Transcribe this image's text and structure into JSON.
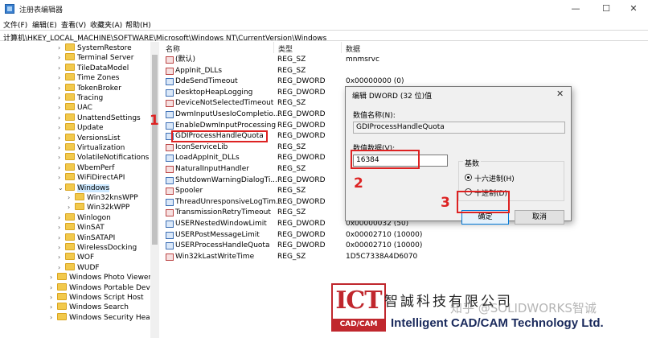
{
  "window": {
    "title": "注册表编辑器"
  },
  "titlebar_buttons": {
    "minimize": "—",
    "maximize": "☐",
    "close": "✕"
  },
  "menu": [
    "文件(F)",
    "编辑(E)",
    "查看(V)",
    "收藏夹(A)",
    "帮助(H)"
  ],
  "address": "计算机\\HKEY_LOCAL_MACHINE\\SOFTWARE\\Microsoft\\Windows NT\\CurrentVersion\\Windows",
  "tree": [
    {
      "label": "SystemRestore",
      "indent": 1
    },
    {
      "label": "Terminal Server",
      "indent": 1
    },
    {
      "label": "TileDataModel",
      "indent": 1
    },
    {
      "label": "Time Zones",
      "indent": 1
    },
    {
      "label": "TokenBroker",
      "indent": 1
    },
    {
      "label": "Tracing",
      "indent": 1
    },
    {
      "label": "UAC",
      "indent": 1
    },
    {
      "label": "UnattendSettings",
      "indent": 1
    },
    {
      "label": "Update",
      "indent": 1
    },
    {
      "label": "VersionsList",
      "indent": 1
    },
    {
      "label": "Virtualization",
      "indent": 1
    },
    {
      "label": "VolatileNotifications",
      "indent": 1
    },
    {
      "label": "WbemPerf",
      "indent": 1
    },
    {
      "label": "WiFiDirectAPI",
      "indent": 1
    },
    {
      "label": "Windows",
      "indent": 1,
      "selected": true,
      "open": true
    },
    {
      "label": "Win32knsWPP",
      "indent": 2
    },
    {
      "label": "Win32kWPP",
      "indent": 2
    },
    {
      "label": "Winlogon",
      "indent": 1
    },
    {
      "label": "WinSAT",
      "indent": 1
    },
    {
      "label": "WinSATAPI",
      "indent": 1
    },
    {
      "label": "WirelessDocking",
      "indent": 1
    },
    {
      "label": "WOF",
      "indent": 1
    },
    {
      "label": "WUDF",
      "indent": 1
    },
    {
      "label": "Windows Photo Viewer",
      "indent": 0
    },
    {
      "label": "Windows Portable Devices",
      "indent": 0
    },
    {
      "label": "Windows Script Host",
      "indent": 0
    },
    {
      "label": "Windows Search",
      "indent": 0
    },
    {
      "label": "Windows Security Health",
      "indent": 0
    }
  ],
  "columns": {
    "name": "名称",
    "type": "类型",
    "data": "数据"
  },
  "values": [
    {
      "name": "(默认)",
      "type": "REG_SZ",
      "data": "mnmsrvc",
      "kind": "sz"
    },
    {
      "name": "AppInit_DLLs",
      "type": "REG_SZ",
      "data": "",
      "kind": "sz"
    },
    {
      "name": "DdeSendTimeout",
      "type": "REG_DWORD",
      "data": "0x00000000 (0)",
      "kind": "dw"
    },
    {
      "name": "DesktopHeapLogging",
      "type": "REG_DWORD",
      "data": "",
      "kind": "dw"
    },
    {
      "name": "DeviceNotSelectedTimeout",
      "type": "REG_SZ",
      "data": "",
      "kind": "sz"
    },
    {
      "name": "DwmInputUsesIoCompletio...",
      "type": "REG_DWORD",
      "data": "",
      "kind": "dw"
    },
    {
      "name": "EnableDwmInputProcessing",
      "type": "REG_DWORD",
      "data": "",
      "kind": "dw"
    },
    {
      "name": "GDIProcessHandleQuota",
      "type": "REG_DWORD",
      "data": "",
      "kind": "dw",
      "selected": true
    },
    {
      "name": "IconServiceLib",
      "type": "REG_SZ",
      "data": "",
      "kind": "sz"
    },
    {
      "name": "LoadAppInit_DLLs",
      "type": "REG_DWORD",
      "data": "",
      "kind": "dw"
    },
    {
      "name": "NaturalInputHandler",
      "type": "REG_SZ",
      "data": "",
      "kind": "sz"
    },
    {
      "name": "ShutdownWarningDialogTi...",
      "type": "REG_DWORD",
      "data": "",
      "kind": "dw"
    },
    {
      "name": "Spooler",
      "type": "REG_SZ",
      "data": "",
      "kind": "sz"
    },
    {
      "name": "ThreadUnresponsiveLogTim...",
      "type": "REG_DWORD",
      "data": "",
      "kind": "dw"
    },
    {
      "name": "TransmissionRetryTimeout",
      "type": "REG_SZ",
      "data": "",
      "kind": "sz"
    },
    {
      "name": "USERNestedWindowLimit",
      "type": "REG_DWORD",
      "data": "0x00000032 (50)",
      "kind": "dw"
    },
    {
      "name": "USERPostMessageLimit",
      "type": "REG_DWORD",
      "data": "0x00002710 (10000)",
      "kind": "dw"
    },
    {
      "name": "USERProcessHandleQuota",
      "type": "REG_DWORD",
      "data": "0x00002710 (10000)",
      "kind": "dw"
    },
    {
      "name": "Win32kLastWriteTime",
      "type": "REG_SZ",
      "data": "1D5C7338A4D6070",
      "kind": "sz"
    }
  ],
  "dialog": {
    "title": "编辑 DWORD (32 位)值",
    "close": "✕",
    "name_label": "数值名称(N):",
    "name_value": "GDIProcessHandleQuota",
    "data_label": "数值数据(V):",
    "data_value": "16384",
    "base_label": "基数",
    "hex_label": "● 十六进制(H)",
    "dec_label": "○ 十进制(D)",
    "hex_text": "十六进制(H)",
    "dec_text": "十进制(D)",
    "ok": "确定",
    "cancel": "取消"
  },
  "annotations": {
    "one": "1",
    "two": "2",
    "three": "3"
  },
  "watermark": {
    "company_cn": "智誠科技有限公司",
    "zhihu": "知乎 @SOLIDWORKS智诚",
    "company_en": "Intelligent CAD/CAM Technology Ltd.",
    "logo_top": "ICT",
    "logo_bottom": "CAD/CAM"
  },
  "colors": {
    "accent": "#0078d7",
    "annotation": "#d22222",
    "logo": "#c0272d"
  }
}
